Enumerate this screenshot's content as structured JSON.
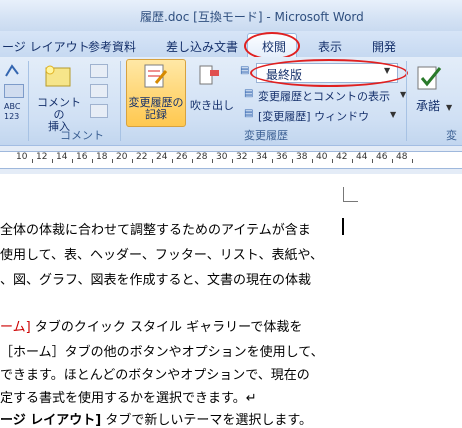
{
  "title": "履歴.doc [互換モード] - Microsoft Word",
  "tabs": [
    "ージ レイアウト",
    "参考資料",
    "差し込み文書",
    "校閲",
    "表示",
    "開発"
  ],
  "ribbon": {
    "comment_insert": "コメントの\n挿入",
    "comment_group": "コメント",
    "track_changes": "変更履歴の\n記録",
    "balloons": "吹き出し",
    "display_mode": "最終版",
    "show_markup": "変更履歴とコメントの表示",
    "reviewing_pane": "[変更履歴] ウィンドウ",
    "track_group": "変更履歴",
    "accept": "承諾",
    "next_group_partial": "変"
  },
  "ruler": [
    "10",
    "12",
    "14",
    "16",
    "18",
    "20",
    "22",
    "24",
    "26",
    "28",
    "30",
    "32",
    "34",
    "36",
    "38",
    "40",
    "42",
    "44",
    "46",
    "48"
  ],
  "document": {
    "line1": "全体の体裁に合わせて調整するためのアイテムが含ま",
    "line2": "使用して、表、ヘッダー、フッター、リスト、表紙や、",
    "line3": "、図、グラフ、図表を作成すると、文書の現在の体裁",
    "line4_red": "ーム]",
    "line4_rest": "タブのクイック スタイル ギャラリーで体裁を",
    "line5": "［ホーム］タブの他のボタンやオプションを使用して、",
    "line6": "できます。ほとんどのボタンやオプションで、現在の",
    "line7": "定する書式を使用するかを選択できます。↵",
    "line8_bold": "ージ レイアウト]",
    "line8_rest": "タブで新しいテーマを選択します。"
  }
}
